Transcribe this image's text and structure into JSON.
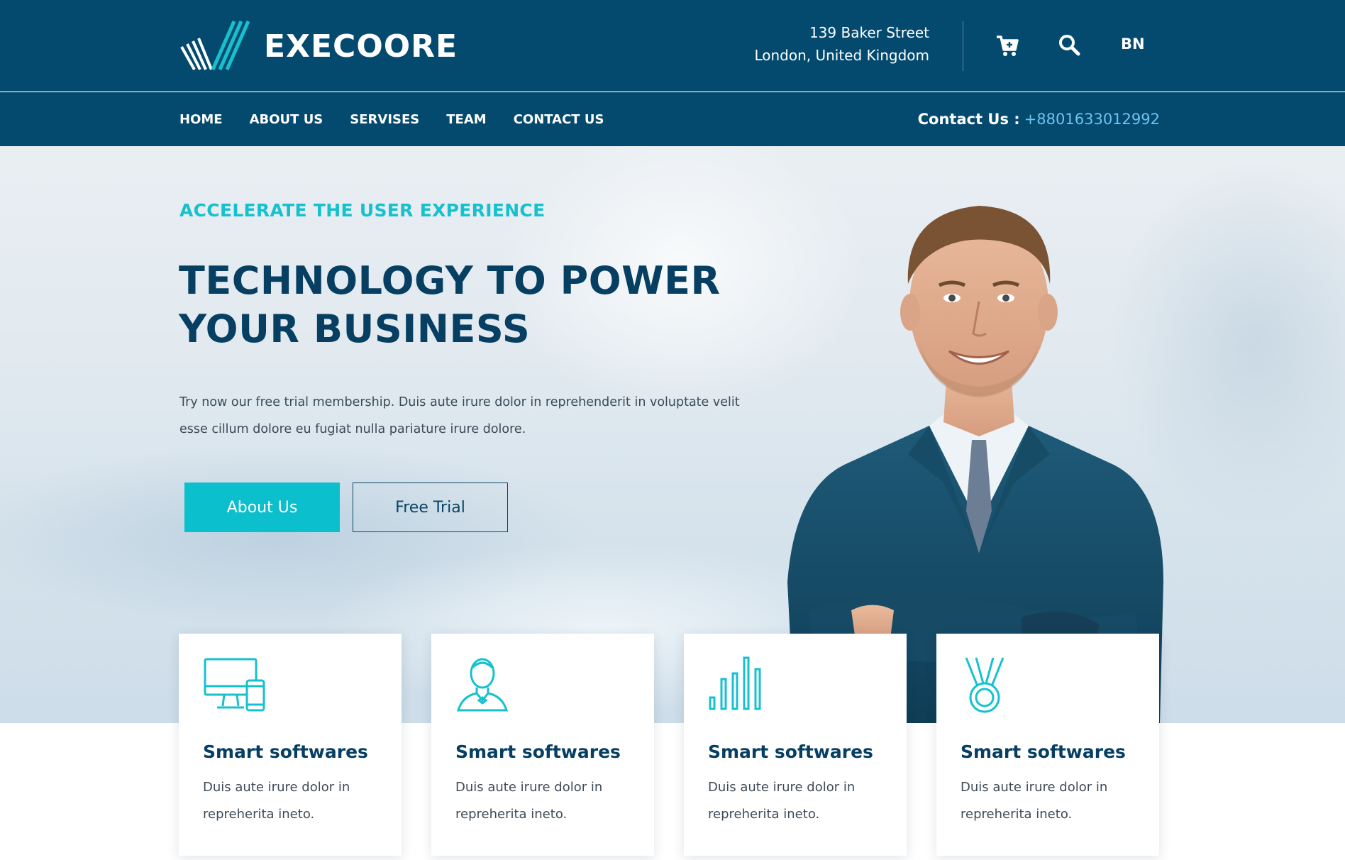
{
  "brand": {
    "name": "EXECOORE"
  },
  "header": {
    "address_line1": "139 Baker Street",
    "address_line2": "London, United Kingdom",
    "cart_icon": "cart-icon",
    "search_icon": "search-icon",
    "language": "BN"
  },
  "nav": {
    "items": [
      {
        "label": "HOME"
      },
      {
        "label": "ABOUT US"
      },
      {
        "label": "SERVISES"
      },
      {
        "label": "TEAM"
      },
      {
        "label": "CONTACT US"
      }
    ],
    "contact_label": "Contact Us :",
    "contact_number": "+8801633012992"
  },
  "hero": {
    "eyebrow": "ACCELERATE THE USER EXPERIENCE",
    "headline_line1": "TECHNOLOGY TO POWER",
    "headline_line2": "YOUR BUSINESS",
    "intro": "Try now our free trial membership. Duis aute irure dolor in reprehenderit in voluptate velit esse cillum dolore eu fugiat nulla pariature irure dolore.",
    "primary_button": "About Us",
    "secondary_button": "Free Trial"
  },
  "features": [
    {
      "icon": "devices-icon",
      "title": "Smart softwares",
      "text": "Duis aute irure dolor in repreherita ineto."
    },
    {
      "icon": "user-icon",
      "title": "Smart softwares",
      "text": "Duis aute irure dolor in repreherita ineto."
    },
    {
      "icon": "bar-chart-icon",
      "title": "Smart softwares",
      "text": "Duis aute irure dolor in repreherita ineto."
    },
    {
      "icon": "medal-icon",
      "title": "Smart softwares",
      "text": "Duis aute irure dolor in repreherita ineto."
    }
  ],
  "colors": {
    "header_bg": "#044a6e",
    "accent": "#0bbfcc",
    "heading": "#063f62",
    "contact_number": "#6fc3ee"
  }
}
